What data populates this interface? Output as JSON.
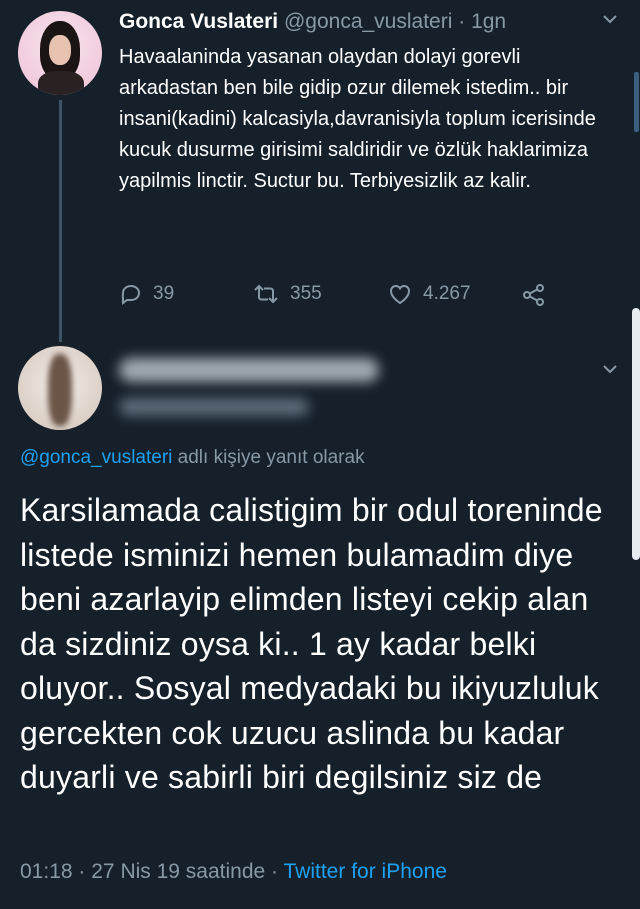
{
  "tweet": {
    "display_name": "Gonca Vuslateri",
    "handle": "@gonca_vuslateri",
    "separator": "·",
    "time_ago": "1gn",
    "text": "Havaalaninda yasanan olaydan dolayi gorevli arkadastan ben bile gidip ozur dilemek istedim.. bir insani(kadini) kalcasiyla,davranisiyla toplum icerisinde kucuk dusurme girisimi saldiridir ve özlük haklarimiza yapilmis linctir. Suctur bu. Terbiyesizlik az kalir.",
    "replies": "39",
    "retweets": "355",
    "likes": "4.267"
  },
  "reply": {
    "replying_to_handle": "@gonca_vuslateri",
    "replying_suffix": "adlı kişiye yanıt olarak",
    "text": "Karsilamada calistigim bir odul toreninde listede isminizi hemen bulamadim diye beni azarlayip elimden listeyi cekip alan da sizdiniz oysa ki.. 1 ay kadar belki oluyor.. Sosyal medyadaki bu ikiyuzluluk gercekten cok uzucu aslinda bu kadar duyarli ve sabirli biri degilsiniz siz de",
    "time": "01:18",
    "date": "27 Nis 19 saatinde",
    "separator": "·",
    "source": "Twitter for iPhone"
  },
  "icons": {
    "reply": "reply-icon",
    "retweet": "retweet-icon",
    "like": "heart-icon",
    "share": "share-icon",
    "menu": "chevron-down-icon"
  },
  "colors": {
    "background": "#15202b",
    "muted": "#8899a6",
    "link": "#1da1f2"
  }
}
